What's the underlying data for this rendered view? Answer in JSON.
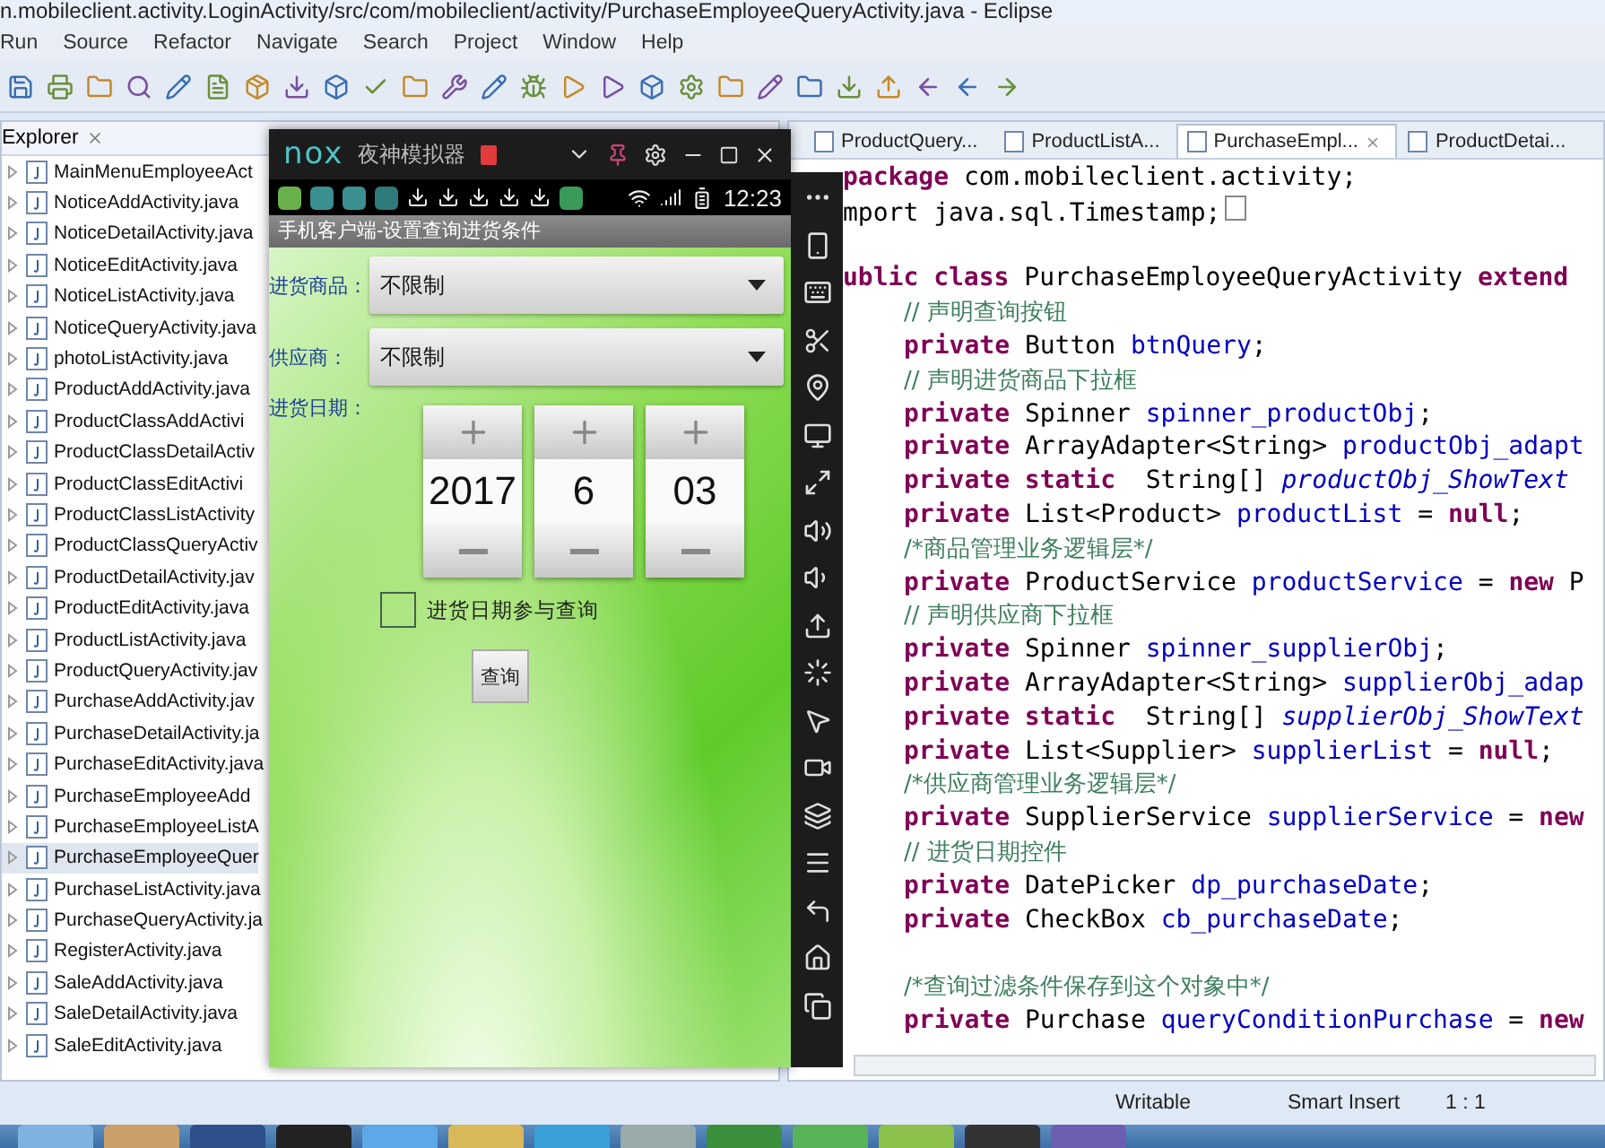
{
  "window": {
    "title": "n.mobileclient.activity.LoginActivity/src/com/mobileclient/activity/PurchaseEmployeeQueryActivity.java - Eclipse"
  },
  "menu": [
    "Run",
    "Source",
    "Refactor",
    "Navigate",
    "Search",
    "Project",
    "Window",
    "Help"
  ],
  "explorer": {
    "title": "Explorer",
    "items": [
      {
        "label": "MainMenuEmployeeAct",
        "selected": false
      },
      {
        "label": "NoticeAddActivity.java",
        "selected": false
      },
      {
        "label": "NoticeDetailActivity.java",
        "selected": false
      },
      {
        "label": "NoticeEditActivity.java",
        "selected": false
      },
      {
        "label": "NoticeListActivity.java",
        "selected": false
      },
      {
        "label": "NoticeQueryActivity.java",
        "selected": false
      },
      {
        "label": "photoListActivity.java",
        "selected": false
      },
      {
        "label": "ProductAddActivity.java",
        "selected": false
      },
      {
        "label": "ProductClassAddActivi",
        "selected": false
      },
      {
        "label": "ProductClassDetailActiv",
        "selected": false
      },
      {
        "label": "ProductClassEditActivi",
        "selected": false
      },
      {
        "label": "ProductClassListActivity",
        "selected": false
      },
      {
        "label": "ProductClassQueryActiv",
        "selected": false
      },
      {
        "label": "ProductDetailActivity.jav",
        "selected": false
      },
      {
        "label": "ProductEditActivity.java",
        "selected": false
      },
      {
        "label": "ProductListActivity.java",
        "selected": false
      },
      {
        "label": "ProductQueryActivity.jav",
        "selected": false
      },
      {
        "label": "PurchaseAddActivity.jav",
        "selected": false
      },
      {
        "label": "PurchaseDetailActivity.ja",
        "selected": false
      },
      {
        "label": "PurchaseEditActivity.java",
        "selected": false
      },
      {
        "label": "PurchaseEmployeeAdd",
        "selected": false
      },
      {
        "label": "PurchaseEmployeeListA",
        "selected": false
      },
      {
        "label": "PurchaseEmployeeQuer",
        "selected": true
      },
      {
        "label": "PurchaseListActivity.java",
        "selected": false
      },
      {
        "label": "PurchaseQueryActivity.ja",
        "selected": false
      },
      {
        "label": "RegisterActivity.java",
        "selected": false
      },
      {
        "label": "SaleAddActivity.java",
        "selected": false
      },
      {
        "label": "SaleDetailActivity.java",
        "selected": false
      },
      {
        "label": "SaleEditActivity.java",
        "selected": false
      }
    ]
  },
  "editor": {
    "tabs": [
      {
        "label": "ProductQuery...",
        "selected": false
      },
      {
        "label": "ProductListA...",
        "selected": false
      },
      {
        "label": "PurchaseEmpl...",
        "selected": true
      },
      {
        "label": "ProductDetai...",
        "selected": false
      }
    ],
    "lines": [
      {
        "indented": false,
        "space_before": false,
        "folded": false,
        "segments": [
          {
            "kind": "keyword",
            "text": "package"
          },
          {
            "kind": "plain",
            "text": " com.mobileclient.activity;"
          }
        ]
      },
      {
        "indented": false,
        "space_before": false,
        "folded": true,
        "segments": [
          {
            "kind": "plain",
            "text": "mport java.sql.Timestamp;"
          }
        ]
      },
      {
        "indented": false,
        "space_before": true,
        "folded": false,
        "segments": [
          {
            "kind": "keyword",
            "text": "ublic class"
          },
          {
            "kind": "plain",
            "text": " PurchaseEmployeeQueryActivity "
          },
          {
            "kind": "keyword",
            "text": "extend"
          }
        ]
      },
      {
        "indented": true,
        "space_before": false,
        "folded": false,
        "segments": [
          {
            "kind": "comment",
            "text": "// 声明查询按钮"
          }
        ]
      },
      {
        "indented": true,
        "space_before": false,
        "folded": false,
        "segments": [
          {
            "kind": "keyword",
            "text": "private"
          },
          {
            "kind": "plain",
            "text": " Button "
          },
          {
            "kind": "field",
            "text": "btnQuery"
          },
          {
            "kind": "plain",
            "text": ";"
          }
        ]
      },
      {
        "indented": true,
        "space_before": false,
        "folded": false,
        "segments": [
          {
            "kind": "comment",
            "text": "// 声明进货商品下拉框"
          }
        ]
      },
      {
        "indented": true,
        "space_before": false,
        "folded": false,
        "segments": [
          {
            "kind": "keyword",
            "text": "private"
          },
          {
            "kind": "plain",
            "text": " Spinner "
          },
          {
            "kind": "field",
            "text": "spinner_productObj"
          },
          {
            "kind": "plain",
            "text": ";"
          }
        ]
      },
      {
        "indented": true,
        "space_before": false,
        "folded": false,
        "segments": [
          {
            "kind": "keyword",
            "text": "private"
          },
          {
            "kind": "plain",
            "text": " ArrayAdapter<String> "
          },
          {
            "kind": "field",
            "text": "productObj_adapt"
          }
        ]
      },
      {
        "indented": true,
        "space_before": false,
        "folded": false,
        "segments": [
          {
            "kind": "keyword",
            "text": "private static"
          },
          {
            "kind": "plain",
            "text": "  String[] "
          },
          {
            "kind": "static",
            "text": "productObj_ShowText"
          }
        ]
      },
      {
        "indented": true,
        "space_before": false,
        "folded": false,
        "segments": [
          {
            "kind": "keyword",
            "text": "private"
          },
          {
            "kind": "plain",
            "text": " List<Product> "
          },
          {
            "kind": "field",
            "text": "productList"
          },
          {
            "kind": "plain",
            "text": " = "
          },
          {
            "kind": "keyword",
            "text": "null"
          },
          {
            "kind": "plain",
            "text": ";"
          }
        ]
      },
      {
        "indented": true,
        "space_before": false,
        "folded": false,
        "segments": [
          {
            "kind": "comment",
            "text": "/*商品管理业务逻辑层*/"
          }
        ]
      },
      {
        "indented": true,
        "space_before": false,
        "folded": false,
        "segments": [
          {
            "kind": "keyword",
            "text": "private"
          },
          {
            "kind": "plain",
            "text": " ProductService "
          },
          {
            "kind": "field",
            "text": "productService"
          },
          {
            "kind": "plain",
            "text": " = "
          },
          {
            "kind": "keyword",
            "text": "new"
          },
          {
            "kind": "plain",
            "text": " P"
          }
        ]
      },
      {
        "indented": true,
        "space_before": false,
        "folded": false,
        "segments": [
          {
            "kind": "comment",
            "text": "// 声明供应商下拉框"
          }
        ]
      },
      {
        "indented": true,
        "space_before": false,
        "folded": false,
        "segments": [
          {
            "kind": "keyword",
            "text": "private"
          },
          {
            "kind": "plain",
            "text": " Spinner "
          },
          {
            "kind": "field",
            "text": "spinner_supplierObj"
          },
          {
            "kind": "plain",
            "text": ";"
          }
        ]
      },
      {
        "indented": true,
        "space_before": false,
        "folded": false,
        "segments": [
          {
            "kind": "keyword",
            "text": "private"
          },
          {
            "kind": "plain",
            "text": " ArrayAdapter<String> "
          },
          {
            "kind": "field",
            "text": "supplierObj_adap"
          }
        ]
      },
      {
        "indented": true,
        "space_before": false,
        "folded": false,
        "segments": [
          {
            "kind": "keyword",
            "text": "private static"
          },
          {
            "kind": "plain",
            "text": "  String[] "
          },
          {
            "kind": "static",
            "text": "supplierObj_ShowText"
          }
        ]
      },
      {
        "indented": true,
        "space_before": false,
        "folded": false,
        "segments": [
          {
            "kind": "keyword",
            "text": "private"
          },
          {
            "kind": "plain",
            "text": " List<Supplier> "
          },
          {
            "kind": "field",
            "text": "supplierList"
          },
          {
            "kind": "plain",
            "text": " = "
          },
          {
            "kind": "keyword",
            "text": "null"
          },
          {
            "kind": "plain",
            "text": ";"
          }
        ]
      },
      {
        "indented": true,
        "space_before": false,
        "folded": false,
        "segments": [
          {
            "kind": "comment",
            "text": "/*供应商管理业务逻辑层*/"
          }
        ]
      },
      {
        "indented": true,
        "space_before": false,
        "folded": false,
        "segments": [
          {
            "kind": "keyword",
            "text": "private"
          },
          {
            "kind": "plain",
            "text": " SupplierService "
          },
          {
            "kind": "field",
            "text": "supplierService"
          },
          {
            "kind": "plain",
            "text": " = "
          },
          {
            "kind": "keyword",
            "text": "new"
          }
        ]
      },
      {
        "indented": true,
        "space_before": false,
        "folded": false,
        "segments": [
          {
            "kind": "comment",
            "text": "// 进货日期控件"
          }
        ]
      },
      {
        "indented": true,
        "space_before": false,
        "folded": false,
        "segments": [
          {
            "kind": "keyword",
            "text": "private"
          },
          {
            "kind": "plain",
            "text": " DatePicker "
          },
          {
            "kind": "field",
            "text": "dp_purchaseDate"
          },
          {
            "kind": "plain",
            "text": ";"
          }
        ]
      },
      {
        "indented": true,
        "space_before": false,
        "folded": false,
        "segments": [
          {
            "kind": "keyword",
            "text": "private"
          },
          {
            "kind": "plain",
            "text": " CheckBox "
          },
          {
            "kind": "field",
            "text": "cb_purchaseDate"
          },
          {
            "kind": "plain",
            "text": ";"
          }
        ]
      },
      {
        "indented": true,
        "space_before": true,
        "folded": false,
        "segments": [
          {
            "kind": "comment",
            "text": "/*查询过滤条件保存到这个对象中*/"
          }
        ]
      },
      {
        "indented": true,
        "space_before": false,
        "folded": false,
        "segments": [
          {
            "kind": "keyword",
            "text": "private"
          },
          {
            "kind": "plain",
            "text": " Purchase "
          },
          {
            "kind": "field",
            "text": "queryConditionPurchase"
          },
          {
            "kind": "plain",
            "text": " = "
          },
          {
            "kind": "keyword",
            "text": "new"
          }
        ]
      }
    ]
  },
  "status_bar": [
    "Writable",
    "Smart Insert",
    "1 : 1"
  ],
  "emulator": {
    "logo": "nox",
    "title": "夜神模拟器",
    "clock": "12:23",
    "app_title": "手机客户端-设置查询进货条件",
    "fields": [
      {
        "label": "进货商品：",
        "value": "不限制"
      },
      {
        "label": "供应商：",
        "value": "不限制"
      }
    ],
    "date_label": "进货日期：",
    "date": [
      "2017",
      "6",
      "03"
    ],
    "checkbox": {
      "label": "进货日期参与查询",
      "checked": false
    },
    "button": "查询"
  }
}
